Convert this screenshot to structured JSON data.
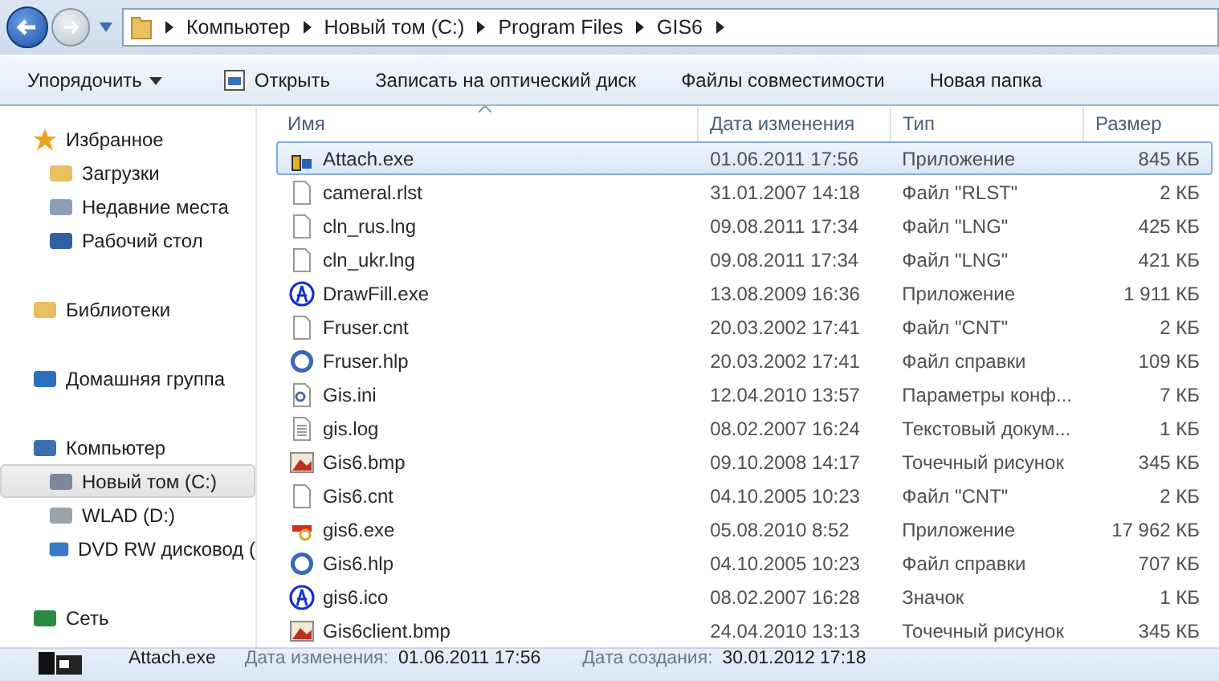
{
  "address_bar": {
    "crumbs": [
      "Компьютер",
      "Новый том (C:)",
      "Program Files",
      "GIS6"
    ]
  },
  "toolbar": {
    "organize": "Упорядочить",
    "items": [
      {
        "label": "Открыть",
        "icon": true
      },
      {
        "label": "Записать на оптический диск",
        "icon": false
      },
      {
        "label": "Файлы совместимости",
        "icon": false
      },
      {
        "label": "Новая папка",
        "icon": false
      }
    ]
  },
  "sidebar": {
    "groups": [
      {
        "label": "Избранное",
        "kind": "star",
        "items": [
          {
            "label": "Загрузки",
            "kind": "downloads",
            "selected": false
          },
          {
            "label": "Недавние места",
            "kind": "recent",
            "selected": false
          },
          {
            "label": "Рабочий стол",
            "kind": "desktop",
            "selected": false
          }
        ]
      },
      {
        "label": "Библиотеки",
        "kind": "library"
      },
      {
        "label": "Домашняя группа",
        "kind": "homegroup"
      },
      {
        "label": "Компьютер",
        "kind": "computer",
        "items": [
          {
            "label": "Новый том (C:)",
            "kind": "system-drive",
            "selected": true
          },
          {
            "label": "WLAD (D:)",
            "kind": "drive",
            "selected": false
          },
          {
            "label": "DVD RW дисковод (",
            "kind": "dvd",
            "selected": false
          }
        ]
      },
      {
        "label": "Сеть",
        "kind": "network"
      }
    ]
  },
  "table": {
    "columns": [
      "Имя",
      "Дата изменения",
      "Тип",
      "Размер"
    ],
    "rows": [
      {
        "name": "Attach.exe",
        "date": "01.06.2011 17:56",
        "type": "Приложение",
        "size": "845 КБ",
        "kind": "app",
        "selected": true
      },
      {
        "name": "cameral.rlst",
        "date": "31.01.2007 14:18",
        "type": "Файл \"RLST\"",
        "size": "2 КБ",
        "kind": "file",
        "selected": false
      },
      {
        "name": "cln_rus.lng",
        "date": "09.08.2011 17:34",
        "type": "Файл \"LNG\"",
        "size": "425 КБ",
        "kind": "file",
        "selected": false
      },
      {
        "name": "cln_ukr.lng",
        "date": "09.08.2011 17:34",
        "type": "Файл \"LNG\"",
        "size": "421 КБ",
        "kind": "file",
        "selected": false
      },
      {
        "name": "DrawFill.exe",
        "date": "13.08.2009 16:36",
        "type": "Приложение",
        "size": "1 911 КБ",
        "kind": "globe",
        "selected": false
      },
      {
        "name": "Fruser.cnt",
        "date": "20.03.2002 17:41",
        "type": "Файл \"CNT\"",
        "size": "2 КБ",
        "kind": "file",
        "selected": false
      },
      {
        "name": "Fruser.hlp",
        "date": "20.03.2002 17:41",
        "type": "Файл справки",
        "size": "109 КБ",
        "kind": "help",
        "selected": false
      },
      {
        "name": "Gis.ini",
        "date": "12.04.2010 13:57",
        "type": "Параметры конф...",
        "size": "7 КБ",
        "kind": "settings",
        "selected": false
      },
      {
        "name": "gis.log",
        "date": "08.02.2007 16:24",
        "type": "Текстовый докум...",
        "size": "1 КБ",
        "kind": "text",
        "selected": false
      },
      {
        "name": "Gis6.bmp",
        "date": "09.10.2008 14:17",
        "type": "Точечный рисунок",
        "size": "345 КБ",
        "kind": "bitmap",
        "selected": false
      },
      {
        "name": "Gis6.cnt",
        "date": "04.10.2005 10:23",
        "type": "Файл \"CNT\"",
        "size": "2 КБ",
        "kind": "file",
        "selected": false
      },
      {
        "name": "gis6.exe",
        "date": "05.08.2010 8:52",
        "type": "Приложение",
        "size": "17 962 КБ",
        "kind": "gis",
        "selected": false
      },
      {
        "name": "Gis6.hlp",
        "date": "04.10.2005 10:23",
        "type": "Файл справки",
        "size": "707 КБ",
        "kind": "help",
        "selected": false
      },
      {
        "name": "gis6.ico",
        "date": "08.02.2007 16:28",
        "type": "Значок",
        "size": "1 КБ",
        "kind": "globe",
        "selected": false
      },
      {
        "name": "Gis6client.bmp",
        "date": "24.04.2010 13:13",
        "type": "Точечный рисунок",
        "size": "345 КБ",
        "kind": "bitmap",
        "selected": false
      }
    ]
  },
  "status_bar": {
    "name": "Attach.exe",
    "modified_label": "Дата изменения:",
    "modified": "01.06.2011 17:56",
    "created_label": "Дата создания:",
    "created": "30.01.2012 17:18"
  }
}
